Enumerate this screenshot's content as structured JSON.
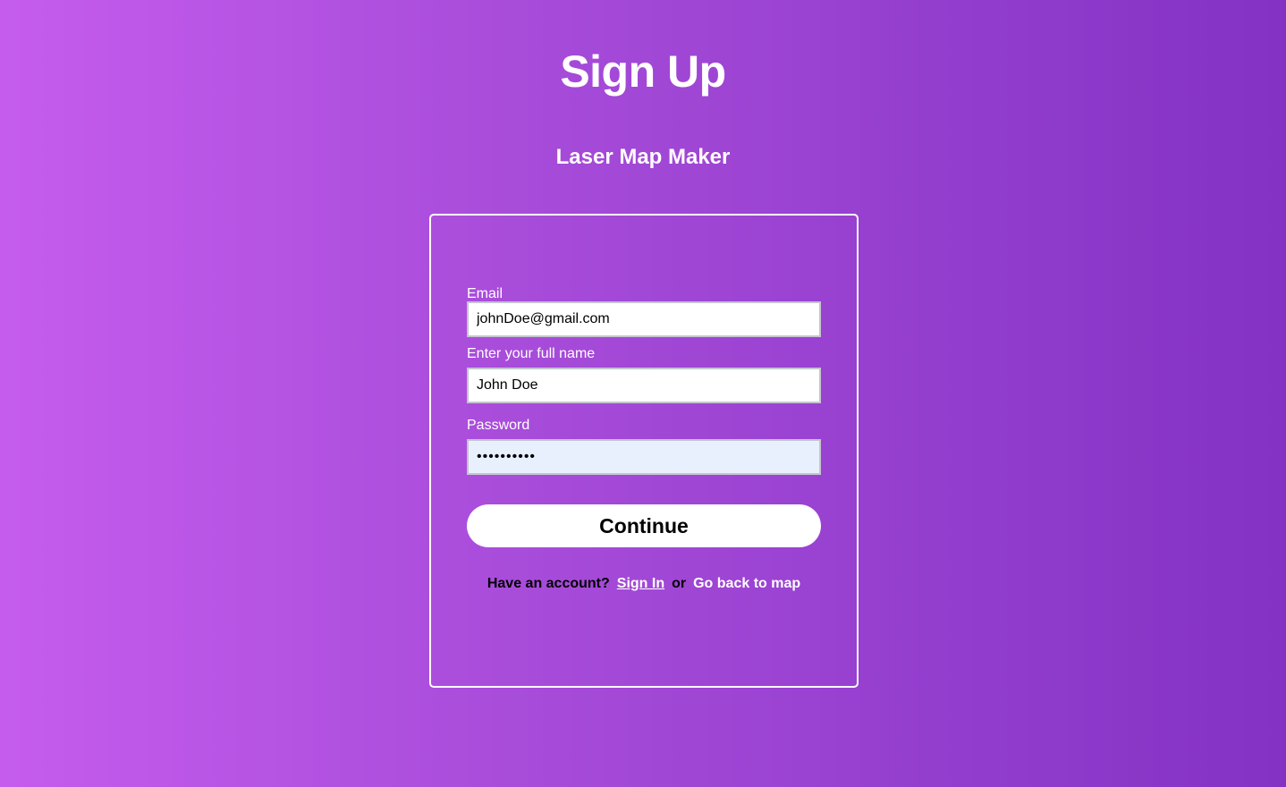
{
  "page": {
    "title": "Sign Up",
    "app_name": "Laser Map Maker"
  },
  "form": {
    "email": {
      "label": "Email",
      "value": "johnDoe@gmail.com"
    },
    "full_name": {
      "label": "Enter your full name",
      "value": "John Doe"
    },
    "password": {
      "label": "Password",
      "value": "••••••••••"
    },
    "continue_label": "Continue"
  },
  "footer": {
    "prompt": "Have an account?",
    "sign_in_label": "Sign In",
    "separator": "or",
    "back_to_map_label": "Go back to map"
  },
  "colors": {
    "gradient_start": "#c55cee",
    "gradient_end": "#8332c4",
    "autofill_background": "#e8f0fe"
  }
}
